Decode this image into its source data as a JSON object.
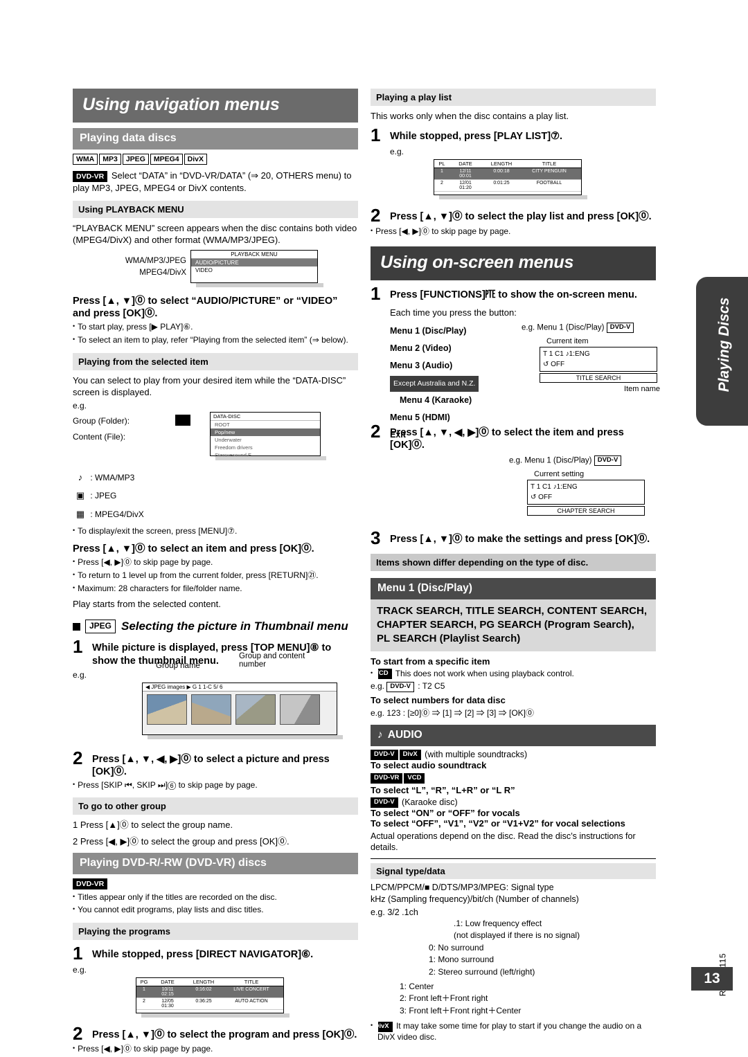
{
  "doc": {
    "page_number": "13",
    "part_number": "RQTX1115",
    "side_tab": "Playing Discs"
  },
  "left": {
    "title": "Using navigation menus",
    "data_discs_header": "Playing data discs",
    "badges": [
      "WMA",
      "MP3",
      "JPEG",
      "MPEG4",
      "DivX"
    ],
    "dvdvr_badge": "DVD-VR",
    "dvdvr_note": "Select “DATA” in “DVD-VR/DATA” (⇒ 20, OTHERS menu) to play MP3, JPEG, MPEG4 or DivX contents.",
    "playback_menu_header": "Using PLAYBACK MENU",
    "playback_menu_text": "“PLAYBACK MENU” screen appears when the disc contains both video (MPEG4/DivX) and other format (WMA/MP3/JPEG).",
    "fig_playback": {
      "label1": "WMA/MP3/JPEG",
      "label2": "MPEG4/DivX",
      "title": "PLAYBACK MENU",
      "row1": "AUDIO/PICTURE",
      "row2": "VIDEO"
    },
    "press_audio_picture": "Press [▲, ▼]⓪ to select “AUDIO/PICTURE” or “VIDEO” and press [OK]⓪.",
    "bullets_audio": [
      "To start play, press [▶ PLAY]⑥.",
      "To select an item to play, refer “Playing from the selected item” (⇒ below)."
    ],
    "selected_item_header": "Playing from the selected item",
    "selected_item_text": "You can select to play from your desired item while the “DATA-DISC” screen is displayed.",
    "eg": "e.g.",
    "group_folder": "Group (Folder):",
    "content_file": "Content (File):",
    "legend": [
      ": WMA/MP3",
      ": JPEG",
      ": MPEG4/DivX"
    ],
    "fig_datadisc": {
      "title": "DATA-DISC",
      "rows": [
        "ROOT",
        "Pop/new",
        "Underwater",
        "Freedom drivers",
        "Starcyesound E"
      ]
    },
    "bullet_menu": "To display/exit the screen, press [MENU]⑦.",
    "press_item_ok": "Press [▲, ▼]⓪ to select an item and press [OK]⓪.",
    "bullets_item": [
      "Press [◀, ▶]⓪ to skip page by page.",
      "To return to 1 level up from the current folder, press [RETURN]㉑.",
      "Maximum: 28 characters for file/folder name."
    ],
    "play_starts": "Play starts from the selected content.",
    "thumbnail_badge": "JPEG",
    "thumbnail_title": "Selecting the picture in Thumbnail menu",
    "step1_thumb": "While picture is displayed, press [TOP MENU]⑧ to show the thumbnail menu.",
    "fig_thumb": {
      "label_group_name": "Group name",
      "label_group_content": "Group and content number",
      "header": "◀ JPEG  images  ▶  G  1   1-C   5/   6"
    },
    "step2_thumb": "Press [▲, ▼, ◀, ▶]⓪ to select a picture and press [OK]⓪.",
    "bullet_thumb": "Press [SKIP ⏮, SKIP ⏭]⑥ to skip page by page.",
    "other_group_header": "To go to other group",
    "other_group_steps": [
      "1  Press [▲]⓪ to select the group name.",
      "2  Press [◀, ▶]⓪ to select the group and press [OK]⓪."
    ],
    "dvdr_header": "Playing DVD-R/-RW (DVD-VR) discs",
    "dvdr_badge": "DVD-VR",
    "dvdr_bullets": [
      "Titles appear only if the titles are recorded on the disc.",
      "You cannot edit programs, play lists and disc titles."
    ],
    "programs_header": "Playing the programs",
    "step1_programs": "While stopped, press [DIRECT NAVIGATOR]⑥.",
    "fig_pg": {
      "headers": [
        "PG",
        "DATE",
        "LENGTH",
        "TITLE"
      ],
      "rows": [
        [
          "1",
          "10/11\n02:15",
          "0:16:02",
          "LIVE CONCERT"
        ],
        [
          "2",
          "12/05\n01:30",
          "0:36:25",
          "AUTO ACTION"
        ]
      ]
    },
    "step2_programs": "Press [▲, ▼]⓪ to select the program and press [OK]⓪.",
    "bullet_programs": "Press [◀, ▶]⓪ to skip page by page."
  },
  "right": {
    "playlist_header": "Playing a play list",
    "playlist_text": "This works only when the disc contains a play list.",
    "step1_playlist": "While stopped, press [PLAY LIST]⑦.",
    "eg": "e.g.",
    "fig_pl": {
      "headers": [
        "PL",
        "DATE",
        "LENGTH",
        "TITLE"
      ],
      "rows": [
        [
          "1",
          "12/11\n00:01",
          "0:00:18",
          "CITY PENGUIN"
        ],
        [
          "2",
          "12/01\n01:20",
          "0:01:25",
          "FOOTBALL"
        ]
      ]
    },
    "step2_playlist": "Press [▲, ▼]⓪ to select the play list and press [OK]⓪.",
    "bullet_playlist": "Press [◀, ▶]⓪ to skip page by page.",
    "onscreen_title": "Using on-screen menus",
    "step1_onscreen": "Press [FUNCTIONS]㉐ to show the on-screen menu.",
    "each_time": "Each time you press the button:",
    "menus": [
      "Menu 1 (Disc/Play)",
      "Menu 2 (Video)",
      "Menu 3 (Audio)",
      "Menu 4 (Karaoke)",
      "Menu 5 (HDMI)",
      "Exit"
    ],
    "except_note": "Except Australia and N.Z.",
    "eg_menu1": "e.g. Menu 1 (Disc/Play)",
    "eg_menu1_badge": "DVD-V",
    "current_item": "Current item",
    "osd1": {
      "line1": "T  1   C1     ♪1:ENG",
      "line2": "↺ OFF",
      "button": "TITLE SEARCH"
    },
    "item_name": "Item name",
    "step2_onscreen": "Press [▲, ▼, ◀, ▶]⓪ to select the item and press [OK]⓪.",
    "current_setting": "Current setting",
    "osd2": {
      "line1": "T 1   C1     ♪1:ENG",
      "line2": "↺ OFF",
      "button": "CHAPTER SEARCH"
    },
    "step3_onscreen": "Press [▲, ▼]⓪ to make the settings and press [OK]⓪.",
    "items_differ": "Items shown differ depending on the type of disc.",
    "menu1_header": "Menu 1 (Disc/Play)",
    "search_title": "TRACK SEARCH, TITLE SEARCH, CONTENT SEARCH, CHAPTER SEARCH, PG SEARCH (Program Search), PL SEARCH (Playlist Search)",
    "start_specific": "To start from a specific item",
    "vcd_badge": "VCD",
    "vcd_note": "This does not work when using playback control.",
    "eg_dvdv": "e.g.",
    "dvdv_badge": "DVD-V",
    "dvdv_value": ": T2 C5",
    "select_numbers": "To select numbers for data disc",
    "eg_numbers": "e.g. 123 : [≥0]⓪ ⇒ [1] ⇒ [2] ⇒ [3] ⇒ [OK]⓪",
    "audio_header": "AUDIO",
    "audio_badges_1": [
      "DVD-V",
      "DivX"
    ],
    "audio_multi": "(with multiple soundtracks)",
    "audio_soundtrack": "To select audio soundtrack",
    "audio_badges_2": [
      "DVD-VR",
      "VCD"
    ],
    "audio_lr": "To select “L”, “R”, “L+R” or “L R”",
    "audio_badges_3": [
      "DVD-V"
    ],
    "audio_karaoke": "(Karaoke disc)",
    "audio_onoff": "To select “ON” or “OFF” for vocals",
    "audio_v1v2": "To select “OFF”, “V1”, “V2” or “V1+V2” for vocal selections",
    "audio_actual": "Actual operations depend on the disc. Read the disc’s instructions for details.",
    "signal_header": "Signal type/data",
    "signal_line1": "LPCM/PPCM/■ D/DTS/MP3/MPEG:  Signal type",
    "signal_line2": "kHz (Sampling frequency)/bit/ch (Number of channels)",
    "signal_eg": "e.g.  3/2 .1ch",
    "signal_notes": [
      ".1: Low frequency effect",
      "(not displayed if there is no signal)",
      "0:  No surround",
      "1:  Mono surround",
      "2:  Stereo surround (left/right)",
      "1:  Center",
      "2:  Front left＋Front right",
      "3:  Front left＋Front right＋Center"
    ],
    "divx_badge": "DivX",
    "divx_note": "It may take some time for play to start if you change the audio on a DivX video disc."
  }
}
